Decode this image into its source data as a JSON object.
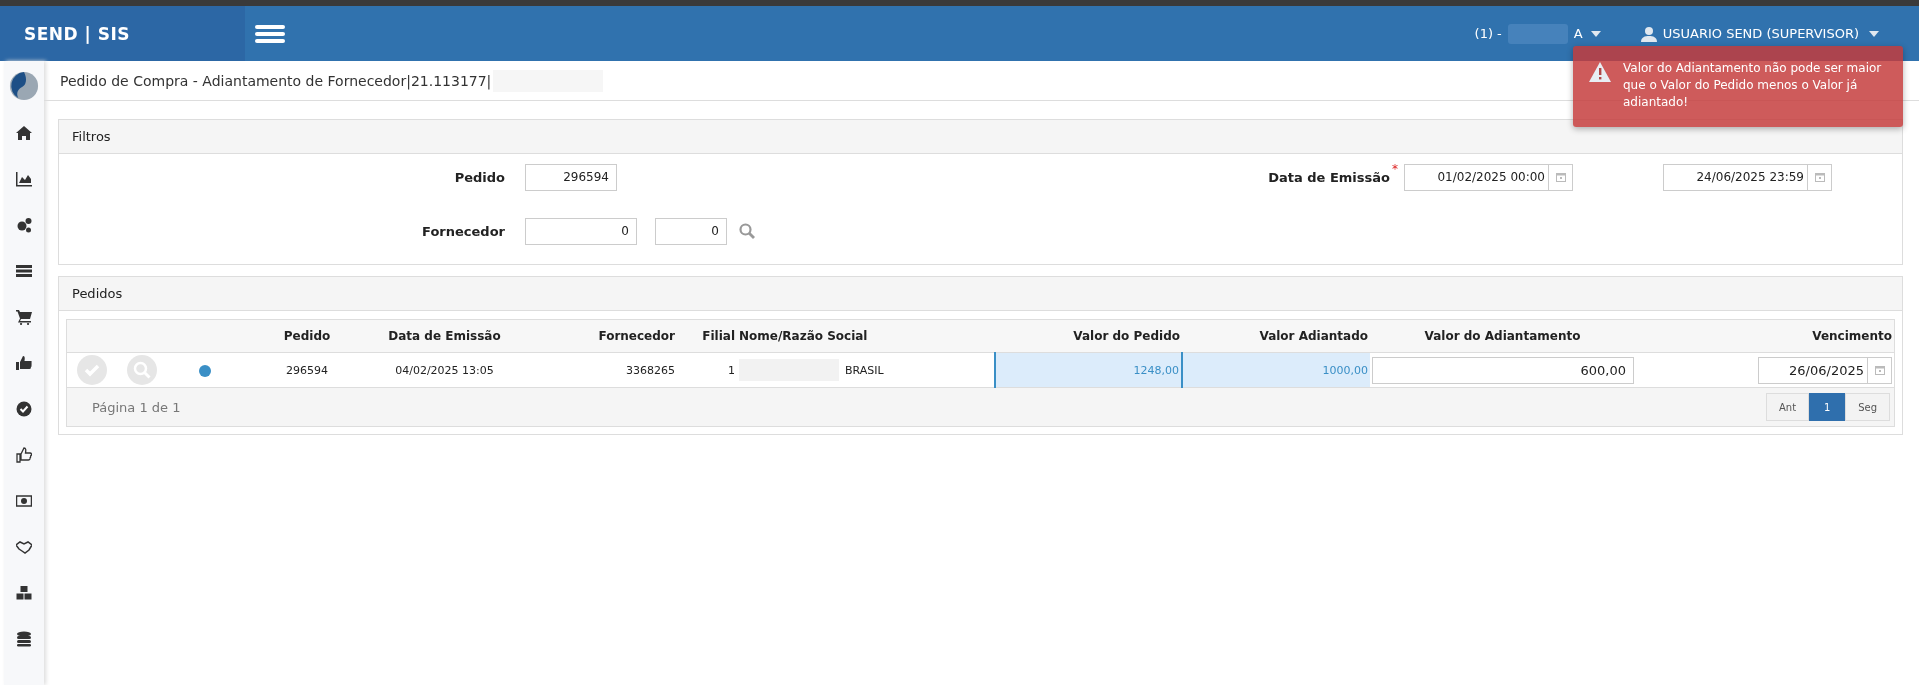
{
  "header": {
    "brand": "SEND | SIS",
    "company_prefix": "(1) -",
    "company_suffix": "A",
    "user": "USUARIO SEND (SUPERVISOR)"
  },
  "page_title": "Pedido de Compra - Adiantamento de Fornecedor|21.113177|",
  "filters": {
    "title": "Filtros",
    "pedido": {
      "label": "Pedido",
      "value": "296594"
    },
    "fornecedor": {
      "label": "Fornecedor",
      "values": [
        "0",
        "0"
      ]
    },
    "data_emissao": {
      "label": "Data de Emissão",
      "required_mark": "*",
      "from": "01/02/2025 00:00",
      "to": "24/06/2025 23:59"
    }
  },
  "orders": {
    "title": "Pedidos",
    "columns": [
      "Pedido",
      "Data de Emissão",
      "Fornecedor",
      "Filial",
      "Nome/Razão Social",
      "Valor do Pedido",
      "Valor Adiantado",
      "Valor do Adiantamento",
      "Vencimento"
    ],
    "rows": [
      {
        "color": "#3a8fc6",
        "pedido": "296594",
        "data": "04/02/2025 13:05",
        "fornecedor": "3368265",
        "filial": "1",
        "nome": "BRASIL",
        "valor_pedido": "1248,00",
        "valor_adiantado": "1000,00",
        "valor_adiantamento": "600,00",
        "vencimento": "26/06/2025"
      }
    ],
    "pager": {
      "text": "Página 1 de 1",
      "prev": "Ant",
      "pages": [
        {
          "label": "1",
          "selected": true
        }
      ],
      "next": "Seg"
    }
  },
  "toast": {
    "message": "Valor do Adiantamento não pode ser maior que o Valor do Pedido menos o Valor já adiantado!"
  }
}
